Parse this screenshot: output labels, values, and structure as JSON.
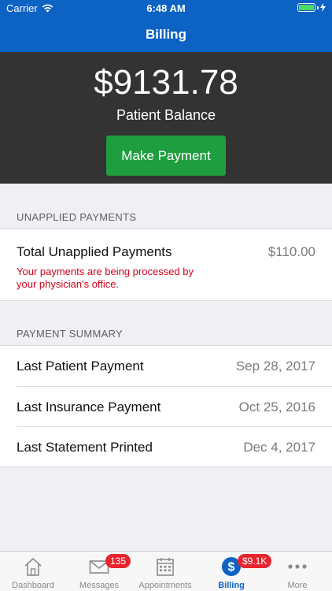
{
  "status_bar": {
    "carrier": "Carrier",
    "time": "6:48 AM"
  },
  "nav": {
    "title": "Billing"
  },
  "balance": {
    "amount": "$9131.78",
    "label": "Patient Balance",
    "pay_button": "Make Payment"
  },
  "unapplied": {
    "header": "UNAPPLIED PAYMENTS",
    "label": "Total Unapplied Payments",
    "value": "$110.00",
    "note": "Your payments are being processed by your physician's office."
  },
  "summary": {
    "header": "PAYMENT SUMMARY",
    "rows": [
      {
        "label": "Last Patient Payment",
        "value": "Sep 28, 2017"
      },
      {
        "label": "Last Insurance Payment",
        "value": "Oct 25, 2016"
      },
      {
        "label": "Last Statement Printed",
        "value": "Dec 4, 2017"
      }
    ]
  },
  "tabs": [
    {
      "label": "Dashboard",
      "icon": "house-icon"
    },
    {
      "label": "Messages",
      "icon": "envelope-icon",
      "badge": "135"
    },
    {
      "label": "Appointments",
      "icon": "calendar-icon"
    },
    {
      "label": "Billing",
      "icon": "dollar-icon",
      "badge": "$9.1K",
      "active": true
    },
    {
      "label": "More",
      "icon": "ellipsis-icon"
    }
  ],
  "colors": {
    "brand_blue": "#0c63c4",
    "pay_green": "#1f9e3f",
    "alert_red": "#d0021b",
    "badge_red": "#e8242e",
    "hero_dark": "#333333"
  }
}
